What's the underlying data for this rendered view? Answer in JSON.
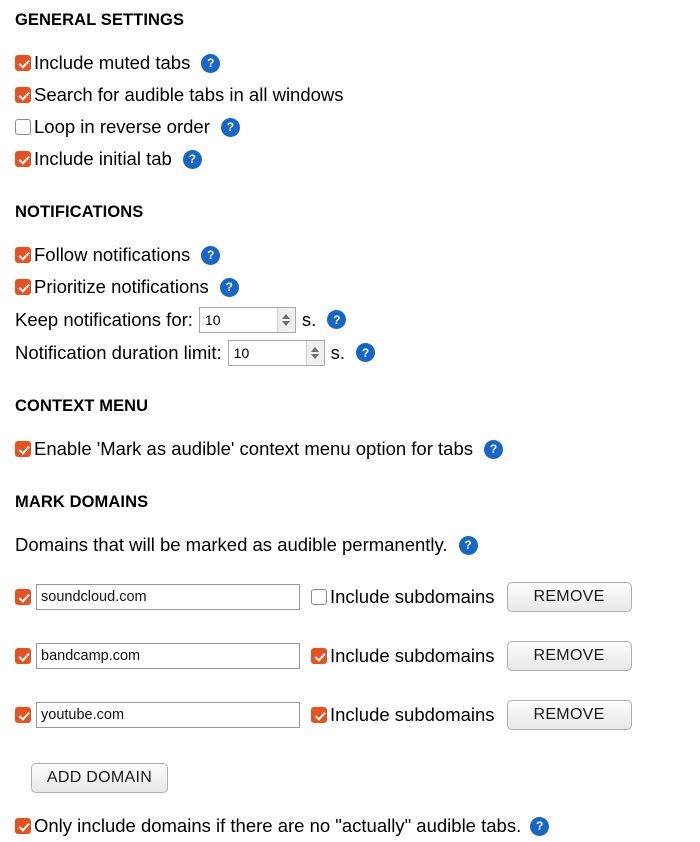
{
  "colors": {
    "checkbox_on": "#e8521f",
    "help_badge": "#1566c8",
    "text": "#000000",
    "background": "#ffffff"
  },
  "icons": {
    "help": "?",
    "check": "checkmark"
  },
  "sections": {
    "general": {
      "title": "GENERAL SETTINGS",
      "options": [
        {
          "label": "Include muted tabs",
          "checked": true,
          "help": true
        },
        {
          "label": "Search for audible tabs in all windows",
          "checked": true,
          "help": false
        },
        {
          "label": "Loop in reverse order",
          "checked": false,
          "help": true
        },
        {
          "label": "Include initial tab",
          "checked": true,
          "help": true
        }
      ]
    },
    "notifications": {
      "title": "NOTIFICATIONS",
      "options": [
        {
          "label": "Follow notifications",
          "checked": true,
          "help": true
        },
        {
          "label": "Prioritize notifications",
          "checked": true,
          "help": true
        }
      ],
      "keep_for": {
        "label": "Keep notifications for:",
        "value": "10",
        "unit": "s.",
        "help": true
      },
      "duration_limit": {
        "label": "Notification duration limit:",
        "value": "10",
        "unit": "s.",
        "help": true
      }
    },
    "context_menu": {
      "title": "CONTEXT MENU",
      "option": {
        "label": "Enable 'Mark as audible' context menu option for tabs",
        "checked": true,
        "help": true
      }
    },
    "mark_domains": {
      "title": "MARK DOMAINS",
      "description": "Domains that will be marked as audible permanently.",
      "description_help": true,
      "subdomain_label": "Include subdomains",
      "remove_label": "REMOVE",
      "add_label": "ADD DOMAIN",
      "rows": [
        {
          "enabled": true,
          "domain": "soundcloud.com",
          "include_subdomains": false
        },
        {
          "enabled": true,
          "domain": "bandcamp.com",
          "include_subdomains": true
        },
        {
          "enabled": true,
          "domain": "youtube.com",
          "include_subdomains": true
        }
      ],
      "only_if_no_audible": {
        "label": "Only include domains if there are no \"actually\" audible tabs.",
        "checked": true,
        "help": true
      }
    }
  }
}
